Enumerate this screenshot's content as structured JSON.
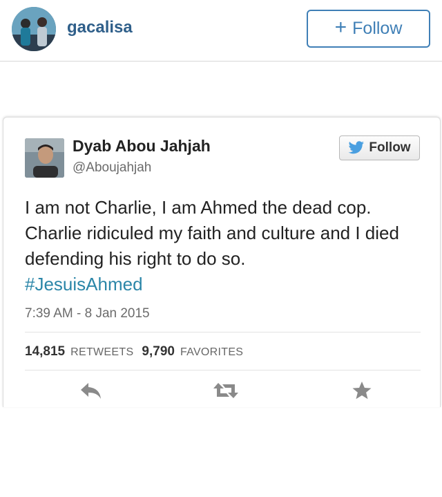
{
  "instagram": {
    "username": "gacalisa",
    "follow_plus": "+",
    "follow_label": "Follow"
  },
  "tweet": {
    "author_name": "Dyab Abou Jahjah",
    "author_handle": "@Aboujahjah",
    "follow_label": "Follow",
    "text": "I am not Charlie, I am Ahmed the dead cop. Charlie ridiculed my faith and culture and I died defending his right to do so.",
    "hashtag": "#JesuisAhmed",
    "timestamp": "7:39 AM - 8 Jan 2015",
    "retweets_count": "14,815",
    "retweets_label": "RETWEETS",
    "favorites_count": "9,790",
    "favorites_label": "FAVORITES",
    "actions": [
      "reply-icon",
      "retweet-icon",
      "favorite-icon"
    ],
    "colors": {
      "hashtag": "#2b86a8",
      "twitter_bird": "#4a9fe0",
      "action_icon": "#8a8a8a"
    }
  }
}
